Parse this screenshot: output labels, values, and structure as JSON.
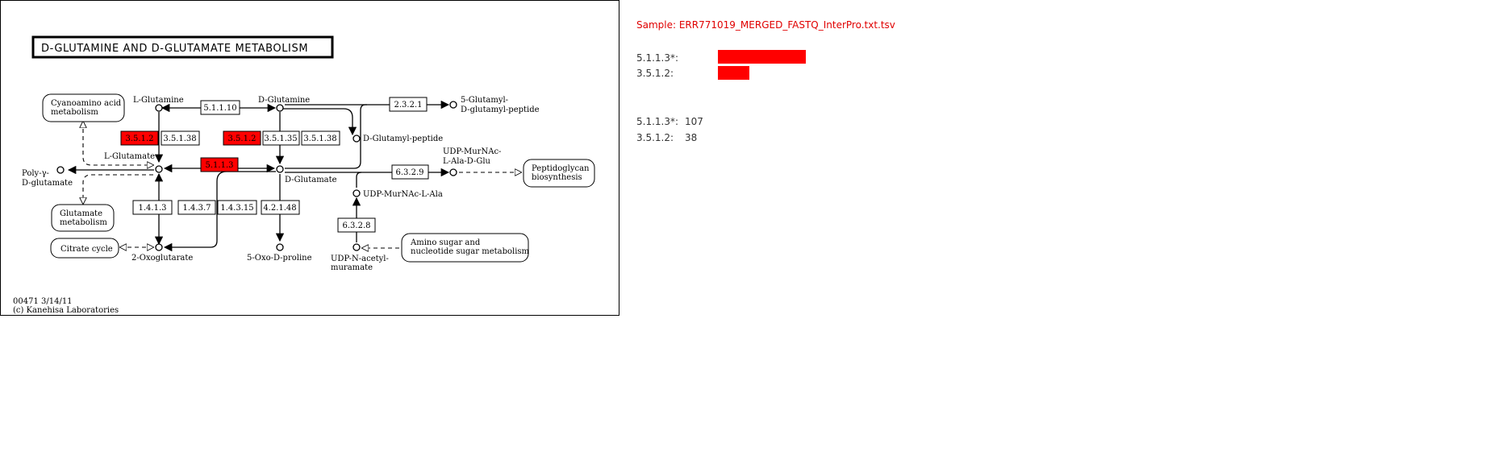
{
  "map": {
    "title": "D-GLUTAMINE AND D-GLUTAMATE METABOLISM",
    "footer_id": "00471 3/14/11",
    "footer_copyright": "(c) Kanehisa Laboratories",
    "highlight_color": "#ff0000",
    "compounds": {
      "l_glutamine": "L-Glutamine",
      "d_glutamine": "D-Glutamine",
      "l_glutamate": "L-Glutamate",
      "d_glutamate": "D-Glutamate",
      "glutamyl_peptide_1": "5-Glutamyl-",
      "glutamyl_peptide_2": "D-glutamyl-peptide",
      "d_glutamyl_peptide": "D-Glutamyl-peptide",
      "poly_glutamate_1": "Poly-γ-",
      "poly_glutamate_2": "D-glutamate",
      "udp_murnac_glu_1": "UDP-MurNAc-",
      "udp_murnac_glu_2": "L-Ala-D-Glu",
      "udp_murnac_ala": "UDP-MurNAc-L-Ala",
      "oxoglutarate": "2-Oxoglutarate",
      "oxoproline": "5-Oxo-D-proline",
      "udp_acetylmuramate_1": "UDP-N-acetyl-",
      "udp_acetylmuramate_2": "muramate"
    },
    "maps": {
      "cyanoamino_1": "Cyanoamino acid",
      "cyanoamino_2": "metabolism",
      "glutamate_1": "Glutamate",
      "glutamate_2": "metabolism",
      "citrate": "Citrate cycle",
      "peptidoglycan_1": "Peptidoglycan",
      "peptidoglycan_2": "biosynthesis",
      "aminosugar_1": "Amino sugar and",
      "aminosugar_2": "nucleotide sugar metabolism"
    },
    "enzymes": {
      "e_5_1_1_10": "5.1.1.10",
      "e_2_3_2_1": "2.3.2.1",
      "e_3_5_1_2_a": "3.5.1.2",
      "e_3_5_1_38_a": "3.5.1.38",
      "e_3_5_1_2_b": "3.5.1.2",
      "e_3_5_1_35": "3.5.1.35",
      "e_3_5_1_38_b": "3.5.1.38",
      "e_5_1_1_3": "5.1.1.3",
      "e_6_3_2_9": "6.3.2.9",
      "e_1_4_1_3": "1.4.1.3",
      "e_1_4_3_7": "1.4.3.7",
      "e_1_4_3_15": "1.4.3.15",
      "e_4_2_1_48": "4.2.1.48",
      "e_6_3_2_8": "6.3.2.8"
    }
  },
  "legend": {
    "sample": "Sample: ERR771019_MERGED_FASTQ_InterPro.txt.tsv",
    "bars": [
      {
        "label": "5.1.1.3*:",
        "count": 107
      },
      {
        "label": "3.5.1.2:",
        "count": 38
      }
    ],
    "counts": [
      {
        "label": "5.1.1.3*:",
        "value": "107"
      },
      {
        "label": "3.5.1.2:",
        "value": "38"
      }
    ]
  }
}
